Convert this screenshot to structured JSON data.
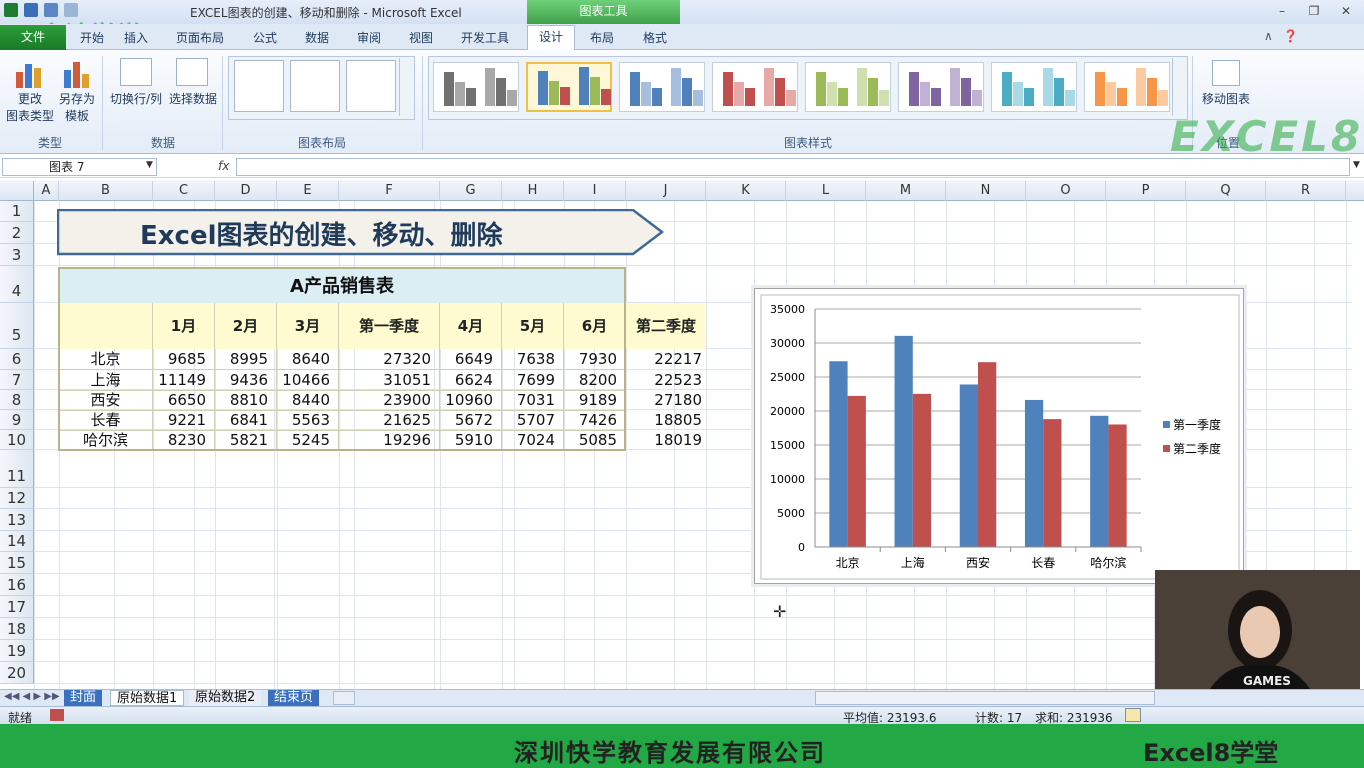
{
  "window": {
    "title": "EXCEL图表的创建、移动和删除 - Microsoft Excel",
    "context_tab": "图表工具"
  },
  "watermarks": {
    "top_left": "会计学堂",
    "ribbon_right": "EXCEL8"
  },
  "ribbon_tabs": [
    "文件",
    "开始",
    "插入",
    "页面布局",
    "公式",
    "数据",
    "审阅",
    "视图",
    "开发工具",
    "设计",
    "布局",
    "格式"
  ],
  "ribbon": {
    "type_group": {
      "label": "类型",
      "change_type": [
        "更改",
        "图表类型"
      ],
      "save_template": [
        "另存为",
        "模板"
      ]
    },
    "data_group": {
      "label": "数据",
      "switch_row_col": "切换行/列",
      "select_data": "选择数据"
    },
    "layout_group": {
      "label": "图表布局"
    },
    "styles_group": {
      "label": "图表样式"
    },
    "location_group": {
      "move_chart": "移动图表",
      "label": "位置"
    }
  },
  "formula_bar": {
    "name_box": "图表 7",
    "fx": "fx",
    "formula": ""
  },
  "columns": [
    "A",
    "B",
    "C",
    "D",
    "E",
    "F",
    "G",
    "H",
    "I",
    "J",
    "K",
    "L",
    "M",
    "N",
    "O",
    "P",
    "Q",
    "R"
  ],
  "rows": [
    "1",
    "2",
    "3",
    "4",
    "5",
    "6",
    "7",
    "8",
    "9",
    "10",
    "11",
    "12",
    "13",
    "14",
    "15",
    "16",
    "17",
    "18",
    "19",
    "20"
  ],
  "banner": {
    "title": "Excel图表的创建、移动、删除"
  },
  "table": {
    "title": "A产品销售表",
    "headers": [
      "",
      "1月",
      "2月",
      "3月",
      "第一季度",
      "4月",
      "5月",
      "6月",
      "第二季度"
    ],
    "rows": [
      [
        "北京",
        "9685",
        "8995",
        "8640",
        "27320",
        "6649",
        "7638",
        "7930",
        "22217"
      ],
      [
        "上海",
        "11149",
        "9436",
        "10466",
        "31051",
        "6624",
        "7699",
        "8200",
        "22523"
      ],
      [
        "西安",
        "6650",
        "8810",
        "8440",
        "23900",
        "10960",
        "7031",
        "9189",
        "27180"
      ],
      [
        "长春",
        "9221",
        "6841",
        "5563",
        "21625",
        "5672",
        "5707",
        "7426",
        "18805"
      ],
      [
        "哈尔滨",
        "8230",
        "5821",
        "5245",
        "19296",
        "5910",
        "7024",
        "5085",
        "18019"
      ]
    ]
  },
  "chart_data": {
    "type": "bar",
    "categories": [
      "北京",
      "上海",
      "西安",
      "长春",
      "哈尔滨"
    ],
    "series": [
      {
        "name": "第一季度",
        "values": [
          27320,
          31051,
          23900,
          21625,
          19296
        ],
        "color": "#4f81bd"
      },
      {
        "name": "第二季度",
        "values": [
          22217,
          22523,
          27180,
          18805,
          18019
        ],
        "color": "#c0504d"
      }
    ],
    "yticks": [
      "0",
      "5000",
      "10000",
      "15000",
      "20000",
      "25000",
      "30000",
      "35000"
    ],
    "ylim": [
      0,
      35000
    ],
    "grid": true,
    "legend": "right"
  },
  "sheet_tabs": [
    "封面",
    "原始数据1",
    "原始数据2",
    "结束页"
  ],
  "status": {
    "ready": "就绪",
    "average": "平均值: 23193.6",
    "count": "计数: 17",
    "sum": "求和: 231936"
  },
  "footer": {
    "company": "深圳快学教育发展有限公司",
    "brand": "Excel8学堂"
  },
  "webcam": {
    "shirt_text": "GAMES"
  }
}
